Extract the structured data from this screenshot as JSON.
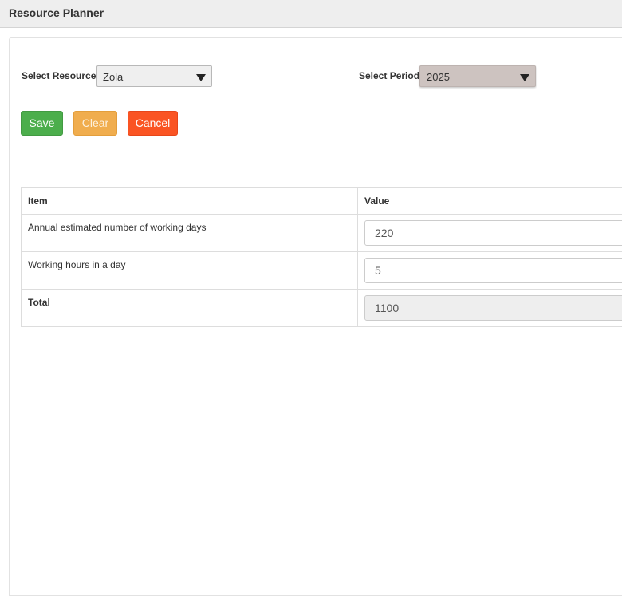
{
  "header": {
    "title": "Resource Planner"
  },
  "filters": {
    "resource_label": "Select Resource",
    "resource_value": "Zola",
    "period_label": "Select Period",
    "period_value": "2025"
  },
  "actions": {
    "save_label": "Save",
    "clear_label": "Clear",
    "cancel_label": "Cancel"
  },
  "colors": {
    "save": "#4cae4c",
    "clear": "#f0ad4e",
    "cancel": "#fa5423"
  },
  "table": {
    "columns": [
      "Item",
      "Value"
    ],
    "rows": [
      {
        "item": "Annual estimated number of working days",
        "value": "220"
      },
      {
        "item": "Working hours in a day",
        "value": "5"
      },
      {
        "item": "Total",
        "value": "1100"
      }
    ]
  }
}
